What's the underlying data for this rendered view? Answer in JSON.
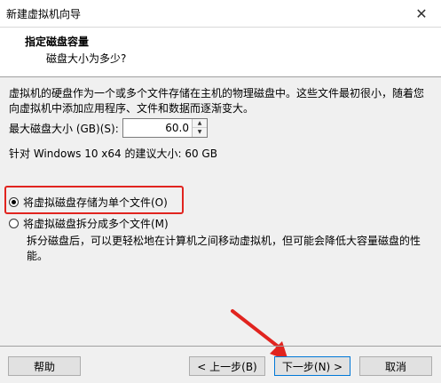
{
  "window": {
    "title": "新建虚拟机向导",
    "close_glyph": "✕"
  },
  "header": {
    "title": "指定磁盘容量",
    "subtitle": "磁盘大小为多少?"
  },
  "main": {
    "description": "虚拟机的硬盘作为一个或多个文件存储在主机的物理磁盘中。这些文件最初很小，随着您向虚拟机中添加应用程序、文件和数据而逐渐变大。",
    "max_size_label": "最大磁盘大小 (GB)(S):",
    "max_size_value": "60.0",
    "recommendation": "针对 Windows 10 x64 的建议大小: 60 GB",
    "options": [
      {
        "label": "将虚拟磁盘存储为单个文件(O)",
        "selected": true
      },
      {
        "label": "将虚拟磁盘拆分成多个文件(M)",
        "selected": false
      }
    ],
    "split_description": "拆分磁盘后，可以更轻松地在计算机之间移动虚拟机，但可能会降低大容量磁盘的性能。"
  },
  "footer": {
    "help": "帮助",
    "back": "< 上一步(B)",
    "next": "下一步(N) >",
    "cancel": "取消"
  },
  "annotation_color": "#e1241f"
}
